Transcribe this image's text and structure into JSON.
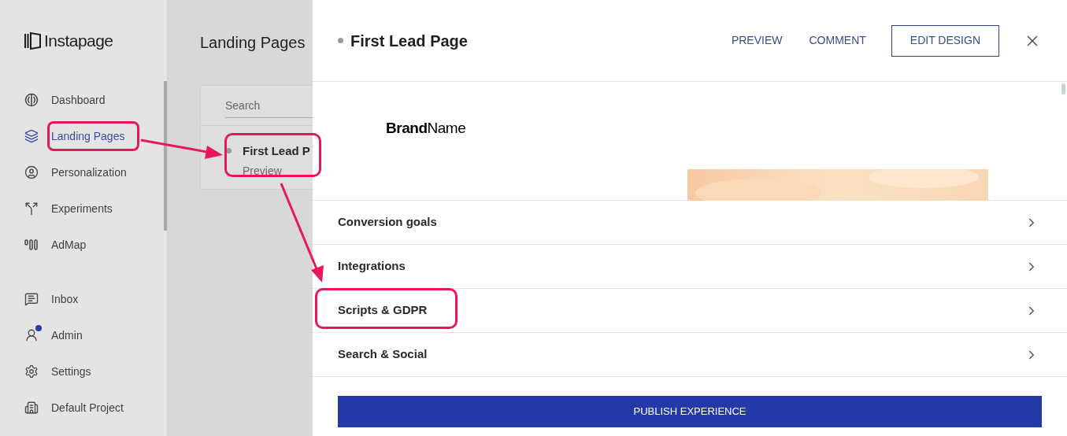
{
  "sidebar": {
    "logo": "Instapage",
    "groups": [
      [
        {
          "label": "Dashboard",
          "selected": false,
          "badge": false
        },
        {
          "label": "Landing Pages",
          "selected": true,
          "badge": false
        },
        {
          "label": "Personalization",
          "selected": false,
          "badge": false
        },
        {
          "label": "Experiments",
          "selected": false,
          "badge": false
        },
        {
          "label": "AdMap",
          "selected": false,
          "badge": false
        }
      ],
      [
        {
          "label": "Inbox",
          "selected": false,
          "badge": false
        },
        {
          "label": "Admin",
          "selected": false,
          "badge": true
        },
        {
          "label": "Settings",
          "selected": false,
          "badge": false
        },
        {
          "label": "Default Project",
          "selected": false,
          "badge": false
        }
      ]
    ]
  },
  "main": {
    "title": "Landing Pages",
    "search": {
      "placeholder": "Search"
    },
    "pages": [
      {
        "title": "First Lead P",
        "subtitle": "Preview"
      }
    ]
  },
  "panel": {
    "title": "First Lead Page",
    "actions": [
      {
        "label": "PREVIEW",
        "kind": "link"
      },
      {
        "label": "COMMENT",
        "kind": "link"
      },
      {
        "label": "EDIT DESIGN",
        "kind": "outlined"
      }
    ],
    "preview": {
      "brand": "**Brand**Name"
    },
    "sections": [
      {
        "label": "Conversion goals",
        "expanded": false
      },
      {
        "label": "Integrations",
        "expanded": false
      },
      {
        "label": "Scripts & GDPR",
        "expanded": false
      },
      {
        "label": "Search & Social",
        "expanded": false
      }
    ],
    "publish": "PUBLISH EXPERIENCE"
  }
}
